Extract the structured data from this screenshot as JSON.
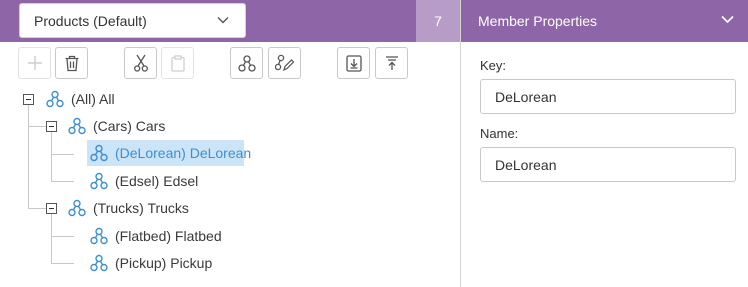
{
  "hierarchy_select": {
    "value": "Products (Default)",
    "icon": "chevron-down-icon"
  },
  "member_count": "7",
  "toolbar": {
    "buttons": [
      {
        "name": "add-button",
        "icon": "plus-icon",
        "enabled": false
      },
      {
        "name": "delete-button",
        "icon": "trash-icon",
        "enabled": true
      },
      {
        "name": "cut-button",
        "icon": "scissors-icon",
        "enabled": true
      },
      {
        "name": "paste-button",
        "icon": "clipboard-icon",
        "enabled": false
      },
      {
        "name": "add-child-button",
        "icon": "hierarchy-icon",
        "enabled": true
      },
      {
        "name": "edit-button",
        "icon": "hierarchy-edit-icon",
        "enabled": true
      },
      {
        "name": "move-down-button",
        "icon": "arrow-down-to-line-icon",
        "enabled": true
      },
      {
        "name": "move-up-button",
        "icon": "arrow-up-from-line-icon",
        "enabled": true
      }
    ]
  },
  "tree": {
    "root": {
      "label": "(All) All",
      "expanded": true
    },
    "groups": [
      {
        "label": "(Cars) Cars",
        "expanded": true,
        "children": [
          {
            "label": "(DeLorean) DeLorean",
            "selected": true
          },
          {
            "label": "(Edsel) Edsel",
            "selected": false
          }
        ]
      },
      {
        "label": "(Trucks) Trucks",
        "expanded": true,
        "children": [
          {
            "label": "(Flatbed) Flatbed",
            "selected": false
          },
          {
            "label": "(Pickup) Pickup",
            "selected": false
          }
        ]
      }
    ]
  },
  "properties": {
    "title": "Member Properties",
    "key_label": "Key:",
    "key_value": "DeLorean",
    "name_label": "Name:",
    "name_value": "DeLorean"
  },
  "colors": {
    "header": "#8e66a8",
    "count_bg": "#b79cc8",
    "selection_bg": "#cce4f7",
    "selection_text": "#3e8fd0",
    "icon_blue": "#3e8fd0"
  }
}
